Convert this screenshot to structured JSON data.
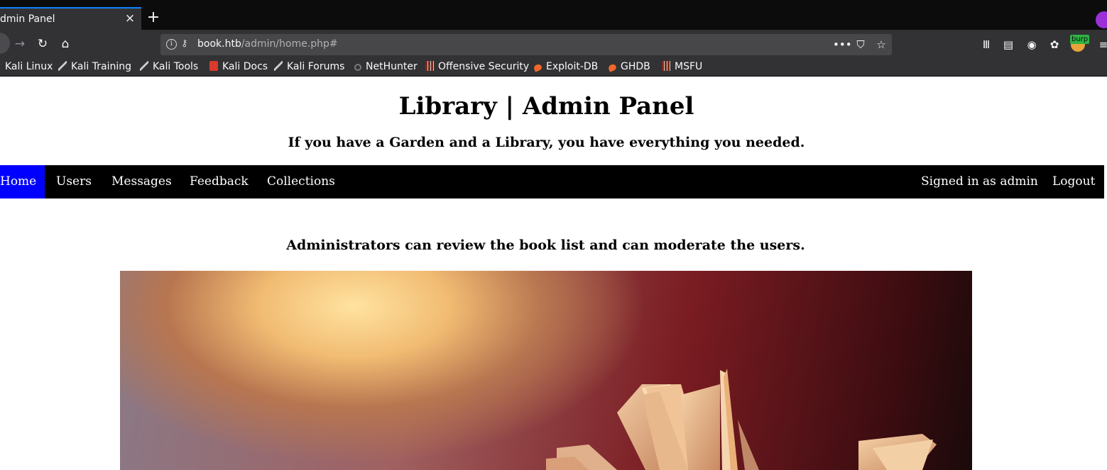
{
  "browser": {
    "tab": {
      "title": "dmin Panel",
      "close": "×"
    },
    "new_tab": "+",
    "url": {
      "host": "book.htb",
      "path": "/admin/home.php#"
    },
    "burp_badge": "burp",
    "bookmarks": [
      {
        "label": "Kali Linux",
        "icon": "kali-dragon-icon"
      },
      {
        "label": "Kali Training",
        "icon": "kali-dragon-icon"
      },
      {
        "label": "Kali Tools",
        "icon": "kali-dragon-icon"
      },
      {
        "label": "Kali Docs",
        "icon": "kali-docs-icon"
      },
      {
        "label": "Kali Forums",
        "icon": "kali-dragon-icon"
      },
      {
        "label": "NetHunter",
        "icon": "nethunter-icon"
      },
      {
        "label": "Offensive Security",
        "icon": "offsec-icon"
      },
      {
        "label": "Exploit-DB",
        "icon": "exploitdb-icon"
      },
      {
        "label": "GHDB",
        "icon": "exploitdb-icon"
      },
      {
        "label": "MSFU",
        "icon": "offsec-icon"
      }
    ]
  },
  "page": {
    "title": "Library | Admin Panel",
    "subtitle": "If you have a Garden and a Library, you have everything you needed.",
    "nav": {
      "items": [
        "Home",
        "Users",
        "Messages",
        "Feedback",
        "Collections"
      ],
      "active": "Home",
      "signed_in": "Signed in as admin",
      "logout": "Logout"
    },
    "note": "Administrators can review the book list and can moderate the users."
  },
  "colors": {
    "nav_bg": "#000000",
    "nav_active": "#0000ff",
    "chrome_dark": "#0c0c0d",
    "chrome_bar": "#323234",
    "tab_accent": "#0a84ff"
  }
}
